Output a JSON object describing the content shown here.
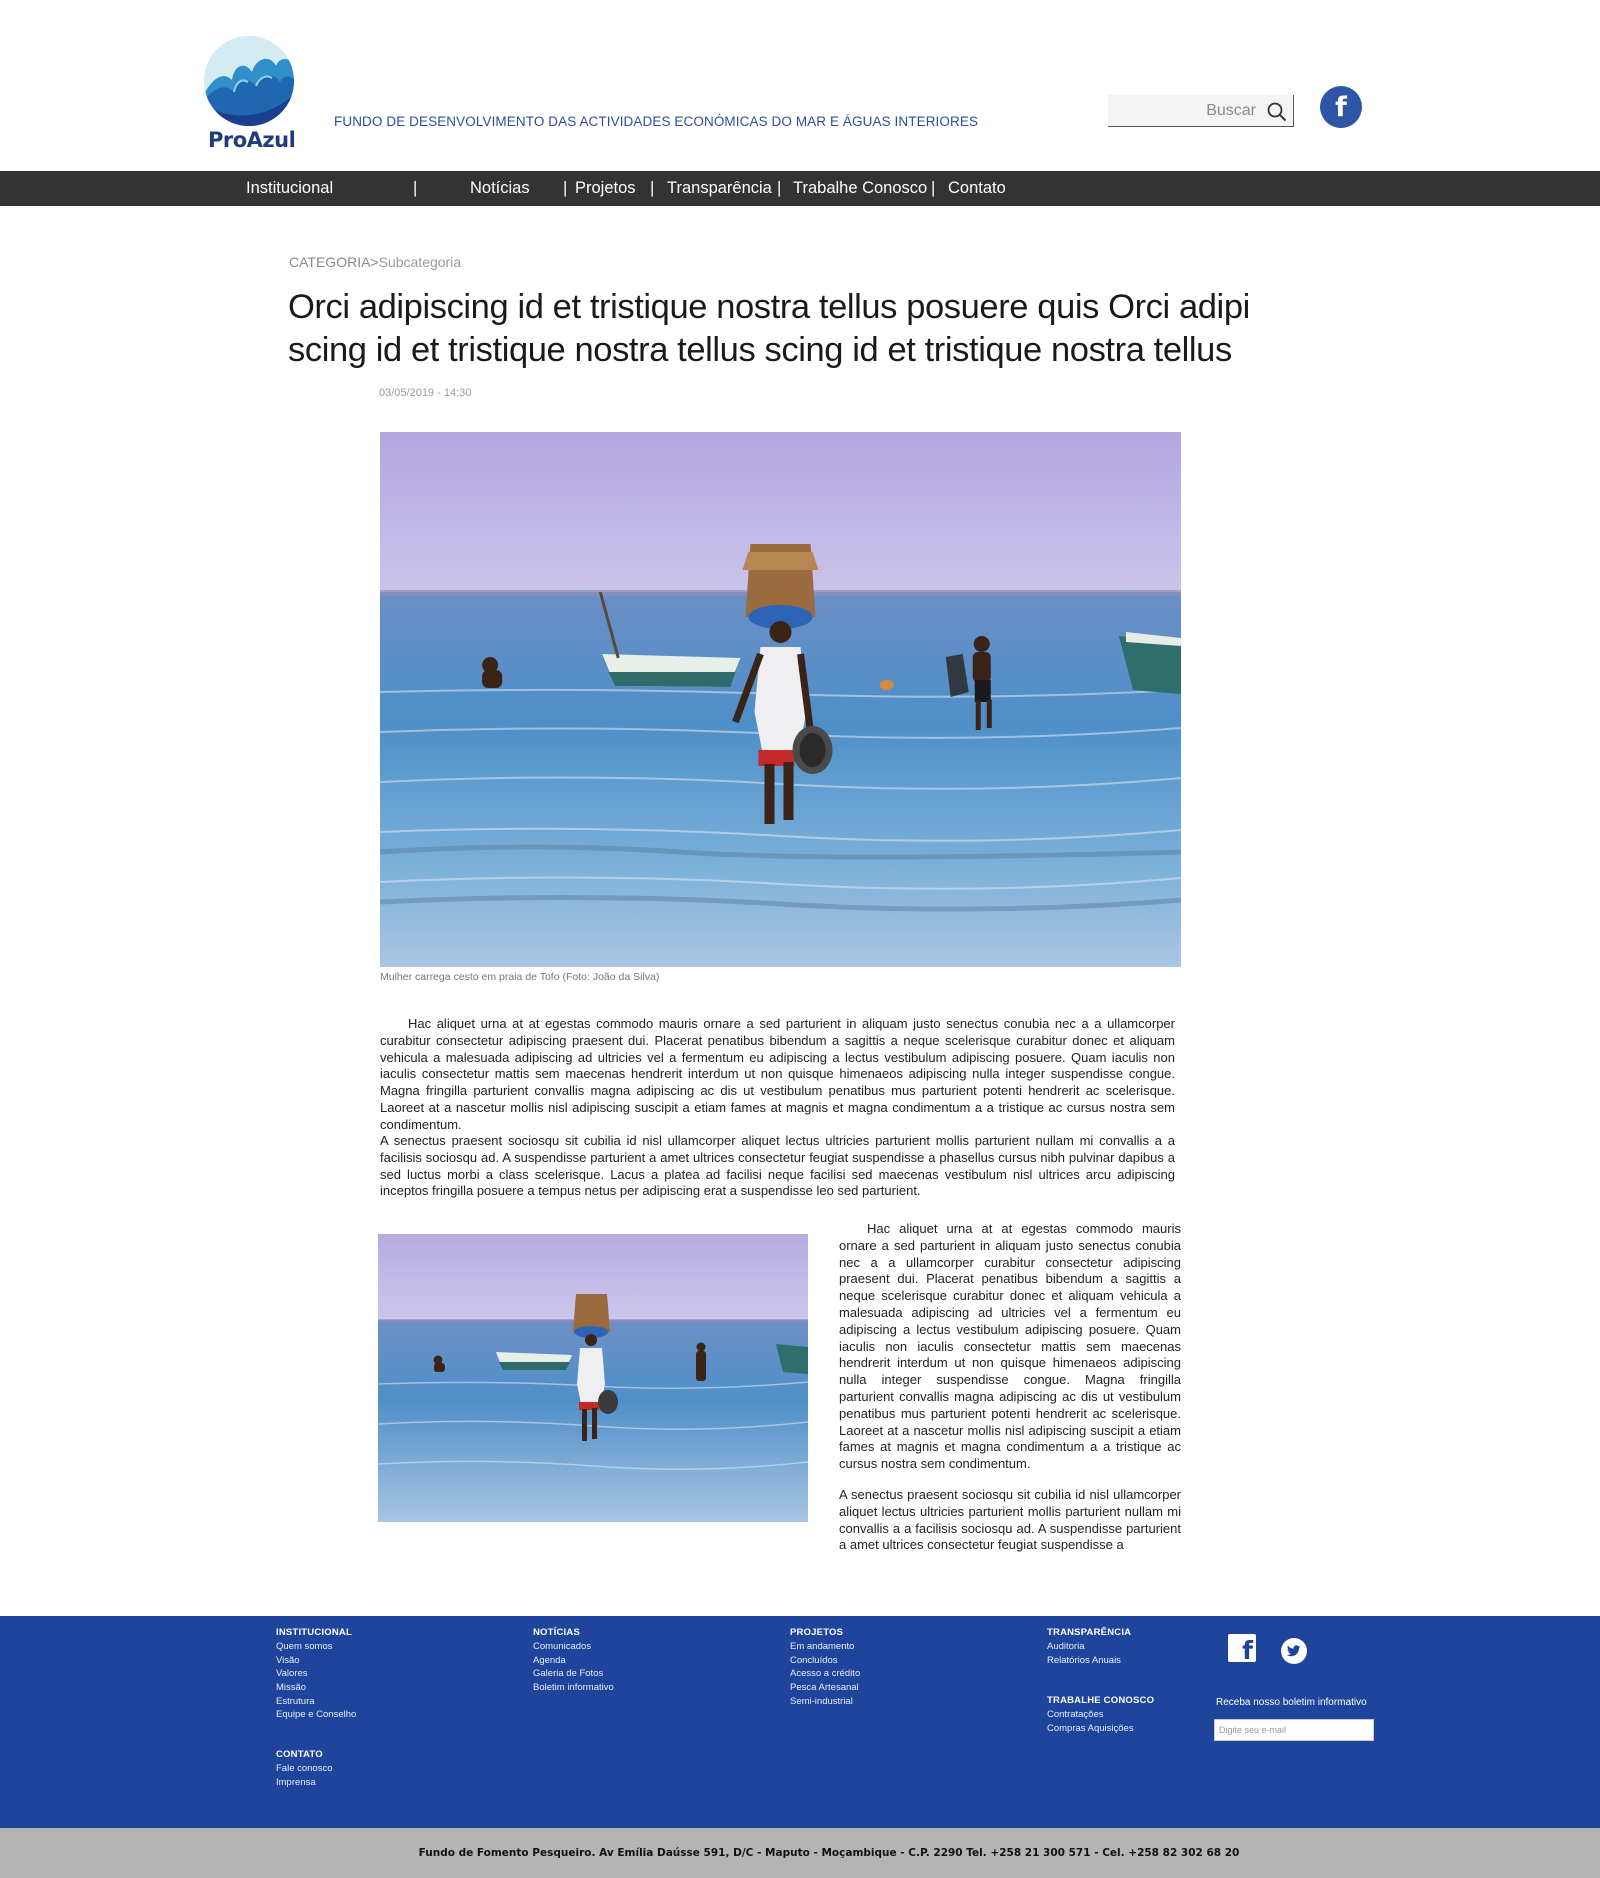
{
  "header": {
    "logo_name": "ProAzul",
    "tagline": "FUNDO DE DESENVOLVIMENTO DAS ACTIVIDADES ECONÓMICAS DO MAR E ÁGUAS INTERIORES",
    "search_placeholder": "Buscar",
    "social_icon": "facebook-icon"
  },
  "nav": {
    "items": [
      "Institucional",
      "Notícias",
      "Projetos",
      "Transparência",
      "Trabalhe Conosco",
      "Contato"
    ],
    "separator": "|"
  },
  "article": {
    "breadcrumb_category": "CATEGORIA",
    "breadcrumb_sep": ">",
    "breadcrumb_sub": "Subcategoria",
    "title_line1": "Orci adipiscing id et tristique nostra tellus posuere quis Orci adipi",
    "title_line2": "scing id et tristique nostra tellus scing id et tristique nostra tellus",
    "date": "03/05/2019 - 14:30",
    "caption": "Mulher carrega cesto em praia de Tofo (Foto: João da Silva)",
    "paragraph1": "Hac aliquet urna at at egestas commodo mauris ornare a sed parturient in aliquam justo senectus conubia nec a a ullamcorper curabitur consectetur adipiscing praesent dui. Placerat penatibus bibendum a sagittis a neque scelerisque curabitur donec et aliquam vehicula a malesuada adipiscing ad ultricies vel a fermentum eu adipiscing a lectus vestibulum adipiscing posuere. Quam iaculis non iaculis consectetur mattis sem maecenas hendrerit interdum ut non quisque himenaeos adipiscing nulla integer suspendisse congue. Magna fringilla parturient convallis magna adipiscing ac dis ut vestibulum penatibus mus parturient potenti hendrerit ac scelerisque. Laoreet at a nascetur mollis nisl adipiscing suscipit a etiam fames at magnis et magna condimentum a a tristique ac cursus nostra sem condimentum.",
    "paragraph2": "A senectus praesent sociosqu sit cubilia id nisl ullamcorper aliquet lectus ultricies parturient mollis parturient nullam mi convallis a a facilisis sociosqu ad. A suspendisse parturient a amet ultrices consectetur feugiat suspendisse a phasellus cursus nibh pulvinar dapibus a sed luctus morbi a class scelerisque. Lacus a platea ad facilisi neque facilisi sed maecenas vestibulum nisl ultrices arcu adipiscing inceptos fringilla posuere a tempus netus per adipiscing erat a suspendisse leo sed parturient.",
    "side_paragraph1": "Hac aliquet urna at at egestas commodo mauris ornare a sed parturient in aliquam justo senectus conubia nec a a ullamcorper curabitur consectetur adipiscing praesent dui. Placerat penatibus bibendum a sagittis a neque scelerisque curabitur donec et aliquam vehicula a malesuada adipiscing ad ultricies vel a fermentum eu adipiscing a lectus vestibulum adipiscing posuere. Quam iaculis non iaculis consectetur mattis sem maecenas hendrerit interdum ut non quisque himenaeos adipiscing nulla integer suspendisse congue. Magna fringilla parturient convallis magna adipiscing ac dis ut vestibulum penatibus mus parturient potenti hendrerit ac scelerisque. Laoreet at a nascetur mollis nisl adipiscing suscipit a etiam fames at magnis et magna condimentum a a tristique ac cursus nostra sem condimentum.",
    "side_paragraph2": "A senectus praesent sociosqu sit cubilia id nisl ullamcorper aliquet lectus ultricies parturient mollis parturient nullam mi convallis a a facilisis sociosqu ad. A suspendisse parturient a amet ultrices consectetur feugiat suspendisse a"
  },
  "footer": {
    "institucional": {
      "heading": "INSTITUCIONAL",
      "links": [
        "Quem somos",
        "Visão",
        "Valores",
        "Missão",
        "Estrutura",
        "Equipe e Conselho"
      ]
    },
    "contato": {
      "heading": "CONTATO",
      "links": [
        "Fale conosco",
        "Imprensa"
      ]
    },
    "noticias": {
      "heading": "NOTÍCIAS",
      "links": [
        "Comunicados",
        "Agenda",
        "Galeria de Fotos",
        "Boletim informativo"
      ]
    },
    "projetos": {
      "heading": "PROJETOS",
      "links": [
        "Em andamento",
        "Concluídos",
        "Acesso a crédito",
        "Pesca Artesanal",
        "Semi-industrial"
      ]
    },
    "transparencia": {
      "heading": "TRANSPARÊNCIA",
      "links": [
        "Auditoria",
        "Relatórios Anuais"
      ]
    },
    "trabalhe": {
      "heading": "TRABALHE CONOSCO",
      "links": [
        "Contratações",
        "Compras Aquisições"
      ]
    },
    "newsletter_label": "Receba nosso boletim informativo",
    "newsletter_placeholder": "Digite seu e-mail",
    "social_icons": [
      "facebook-icon",
      "twitter-icon"
    ],
    "address": "Fundo de Fomento Pesqueiro. Av Emília Daússe 591, D/C - Maputo - Moçambique - C.P. 2290 Tel. +258 21 300 571 - Cel. +258 82 302 68 20"
  },
  "colors": {
    "brand_blue": "#2d4e9e",
    "nav_bg": "#333333",
    "footer_bg": "#1e449c",
    "bottom_bar": "#b4b4b4"
  }
}
